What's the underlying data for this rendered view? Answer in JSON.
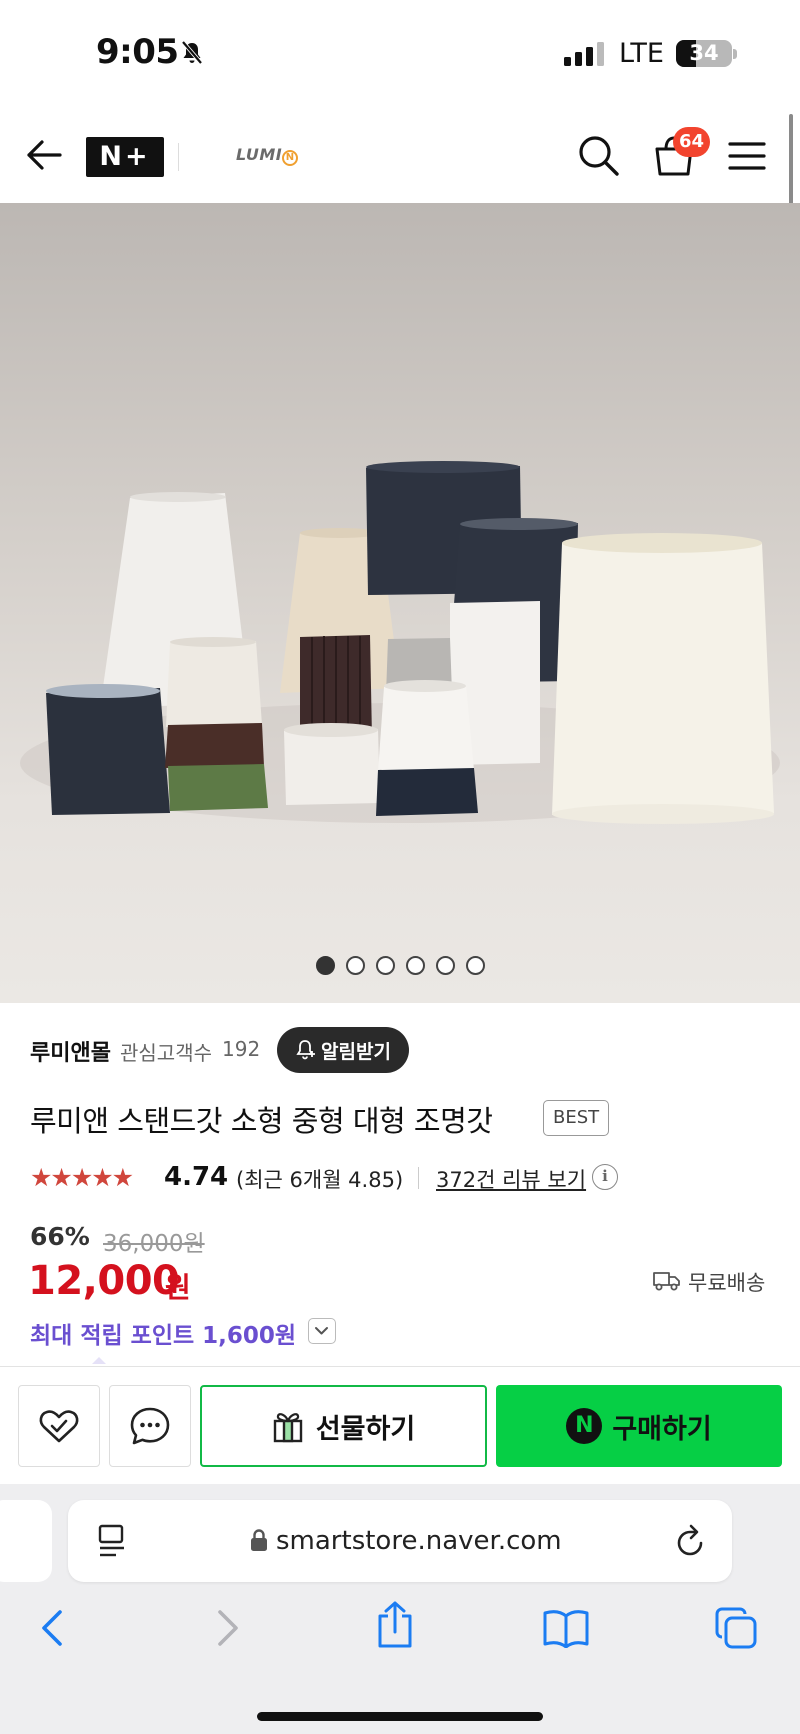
{
  "status_bar": {
    "time": "9:05",
    "network": "LTE",
    "battery": "34"
  },
  "header": {
    "logo": "N+",
    "brand": "LUMI",
    "brand_mark": "N",
    "cart_count": "64"
  },
  "carousel": {
    "total": 6,
    "active_index": 0
  },
  "product": {
    "store_name": "루미앤몰",
    "followers_label": "관심고객수",
    "followers_count": "192",
    "alert_label": "알림받기",
    "title": "루미앤 스탠드갓 소형 중형 대형 조명갓",
    "badge": "BEST",
    "stars": "★★★★★",
    "rating": "4.74",
    "recent_rating": "(최근 6개월 4.85)",
    "reviews_link": "372건 리뷰 보기",
    "info_glyph": "i",
    "discount": "66%",
    "original_price": "36,000원",
    "price": "12,000",
    "currency": "원",
    "shipping": "무료배송",
    "points": "최대 적립 포인트 1,600원"
  },
  "actions": {
    "gift_label": "선물하기",
    "buy_label": "구매하기",
    "npay_glyph": "N"
  },
  "browser": {
    "url": "smartstore.naver.com"
  },
  "colors": {
    "price_red": "#d4111e",
    "naver_green": "#06cf45",
    "points_purple": "#6a4fd0",
    "star_red": "#d0463c",
    "badge_red": "#f2442e"
  }
}
